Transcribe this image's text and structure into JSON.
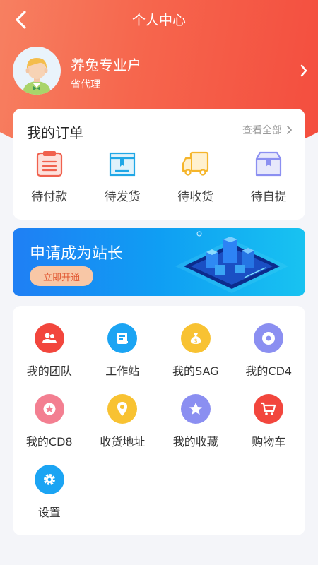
{
  "header": {
    "title": "个人中心"
  },
  "profile": {
    "name": "养兔专业户",
    "role": "省代理"
  },
  "orders": {
    "title": "我的订单",
    "view_all": "查看全部",
    "items": [
      {
        "label": "待付款",
        "icon": "clipboard-icon"
      },
      {
        "label": "待发货",
        "icon": "box-icon"
      },
      {
        "label": "待收货",
        "icon": "truck-icon"
      },
      {
        "label": "待自提",
        "icon": "package-icon"
      }
    ]
  },
  "banner": {
    "title": "申请成为站长",
    "button": "立即开通"
  },
  "menu": {
    "items": [
      {
        "label": "我的团队",
        "icon": "team-icon",
        "color": "#f2463d"
      },
      {
        "label": "工作站",
        "icon": "workstation-icon",
        "color": "#1ba4f3"
      },
      {
        "label": "我的SAG",
        "icon": "money-bag-icon",
        "color": "#f8c232"
      },
      {
        "label": "我的CD4",
        "icon": "disc-icon",
        "color": "#8b8ff1"
      },
      {
        "label": "我的CD8",
        "icon": "badge-icon",
        "color": "#f37f91"
      },
      {
        "label": "收货地址",
        "icon": "location-icon",
        "color": "#f8c232"
      },
      {
        "label": "我的收藏",
        "icon": "star-icon",
        "color": "#8b8ff1"
      },
      {
        "label": "购物车",
        "icon": "cart-icon",
        "color": "#f2463d"
      },
      {
        "label": "设置",
        "icon": "gear-icon",
        "color": "#1ba4f3"
      }
    ]
  }
}
